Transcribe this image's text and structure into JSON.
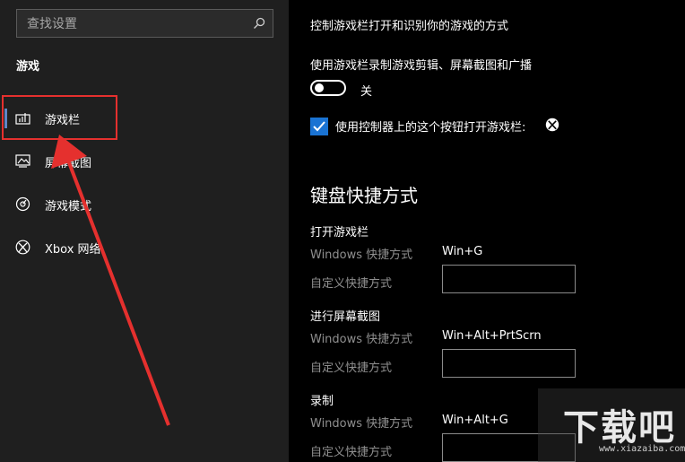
{
  "search": {
    "placeholder": "查找设置"
  },
  "sidebar": {
    "section_title": "游戏",
    "items": [
      {
        "label": "游戏栏",
        "icon": "game-bar-icon"
      },
      {
        "label": "屏幕截图",
        "icon": "capture-icon"
      },
      {
        "label": "游戏模式",
        "icon": "game-mode-icon"
      },
      {
        "label": "Xbox 网络",
        "icon": "xbox-icon"
      }
    ]
  },
  "main": {
    "description": "控制游戏栏打开和识别你的游戏的方式",
    "record_label": "使用游戏栏录制游戏剪辑、屏幕截图和广播",
    "toggle_state": "关",
    "checkbox_label": "使用控制器上的这个按钮打开游戏栏:",
    "checkbox_checked": true,
    "shortcuts_heading": "键盘快捷方式",
    "groups": [
      {
        "title": "打开游戏栏",
        "windows_label": "Windows 快捷方式",
        "windows_value": "Win+G",
        "custom_label": "自定义快捷方式",
        "custom_value": ""
      },
      {
        "title": "进行屏幕截图",
        "windows_label": "Windows 快捷方式",
        "windows_value": "Win+Alt+PrtScrn",
        "custom_label": "自定义快捷方式",
        "custom_value": ""
      },
      {
        "title": "录制",
        "windows_label": "Windows 快捷方式",
        "windows_value": "Win+Alt+G",
        "custom_label": "自定义快捷方式",
        "custom_value": ""
      }
    ]
  },
  "watermark": {
    "text": "下载吧",
    "sub": "www.xiazaiba.com"
  },
  "colors": {
    "accent": "#1a73d3",
    "highlight": "#e5302e",
    "sidebar_bg": "#1f1f1f",
    "active_indicator": "#5f86c7"
  }
}
